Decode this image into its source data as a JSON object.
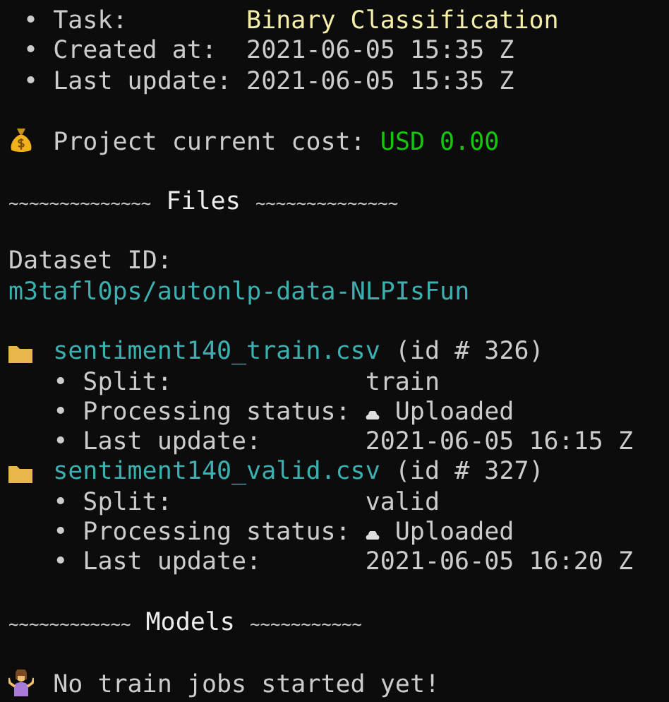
{
  "project": {
    "fields": [
      {
        "bullet": "•",
        "label": "Task:",
        "value": "Binary Classification",
        "kind": "highlight"
      },
      {
        "bullet": "•",
        "label": "Created at:",
        "value": "2021-06-05 15:35 Z",
        "kind": "plain"
      },
      {
        "bullet": "•",
        "label": "Last update:",
        "value": "2021-06-05 15:35 Z",
        "kind": "plain"
      }
    ]
  },
  "cost": {
    "label": "Project current cost:",
    "value": "USD 0.00"
  },
  "files_header": {
    "left": "~~~~~~~~~~~~~~",
    "title": "Files",
    "right": "~~~~~~~~~~~~~~"
  },
  "dataset": {
    "label": "Dataset ID:",
    "value": "m3tafl0ps/autonlp-data-NLPIsFun"
  },
  "files": [
    {
      "name": "sentiment140_train.csv",
      "id": "(id # 326)",
      "fields": [
        {
          "bullet": "•",
          "label": "Split:",
          "value": "train",
          "kind": "plain"
        },
        {
          "bullet": "•",
          "label": "Processing status:",
          "value": "Uploaded",
          "kind": "status"
        },
        {
          "bullet": "•",
          "label": "Last update:",
          "value": "2021-06-05 16:15 Z",
          "kind": "plain"
        }
      ]
    },
    {
      "name": "sentiment140_valid.csv",
      "id": "(id # 327)",
      "fields": [
        {
          "bullet": "•",
          "label": "Split:",
          "value": "valid",
          "kind": "plain"
        },
        {
          "bullet": "•",
          "label": "Processing status:",
          "value": "Uploaded",
          "kind": "status"
        },
        {
          "bullet": "•",
          "label": "Last update:",
          "value": "2021-06-05 16:20 Z",
          "kind": "plain"
        }
      ]
    }
  ],
  "models_header": {
    "left": "~~~~~~~~~~~~",
    "title": "Models",
    "right": "~~~~~~~~~~~"
  },
  "models": {
    "message": "No train jobs started yet!"
  }
}
